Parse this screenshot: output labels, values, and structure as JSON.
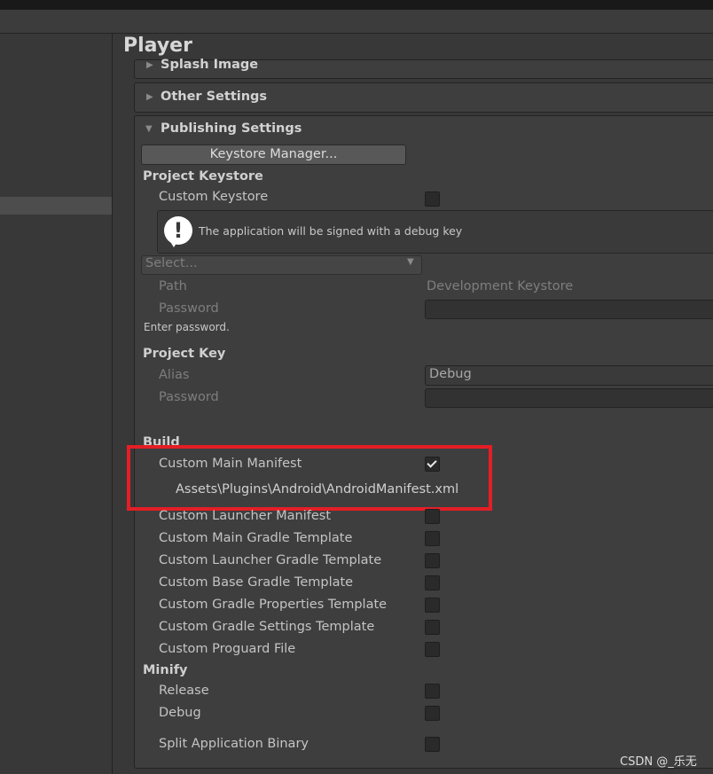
{
  "window": {
    "title": "Player"
  },
  "sections": {
    "splash_image": "Splash Image",
    "other_settings": "Other Settings",
    "publishing_settings": "Publishing Settings"
  },
  "publishing": {
    "keystore_manager_button": "Keystore Manager...",
    "project_keystore": {
      "header": "Project Keystore",
      "custom_keystore_label": "Custom Keystore",
      "custom_keystore_checked": false,
      "help_message": "The application will be signed with a debug key",
      "select_placeholder": "Select...",
      "path_label": "Path",
      "path_value": "Development Keystore",
      "password_label": "Password",
      "password_value": "",
      "enter_password_hint": "Enter password."
    },
    "project_key": {
      "header": "Project Key",
      "alias_label": "Alias",
      "alias_value": "Debug",
      "password_label": "Password",
      "password_value": ""
    },
    "build": {
      "header": "Build",
      "items": [
        {
          "label": "Custom Main Manifest",
          "checked": true
        },
        {
          "label": "Custom Launcher Manifest",
          "checked": false
        },
        {
          "label": "Custom Main Gradle Template",
          "checked": false
        },
        {
          "label": "Custom Launcher Gradle Template",
          "checked": false
        },
        {
          "label": "Custom Base Gradle Template",
          "checked": false
        },
        {
          "label": "Custom Gradle Properties Template",
          "checked": false
        },
        {
          "label": "Custom Gradle Settings Template",
          "checked": false
        },
        {
          "label": "Custom Proguard File",
          "checked": false
        }
      ],
      "manifest_path": "Assets\\Plugins\\Android\\AndroidManifest.xml"
    },
    "minify": {
      "header": "Minify",
      "release_label": "Release",
      "release_checked": false,
      "debug_label": "Debug",
      "debug_checked": false
    },
    "split_binary": {
      "label": "Split Application Binary",
      "checked": false
    }
  },
  "watermark": "CSDN @_乐无",
  "colors": {
    "highlight": "#e41e26",
    "background": "#383838",
    "field": "#2a2a2a"
  }
}
